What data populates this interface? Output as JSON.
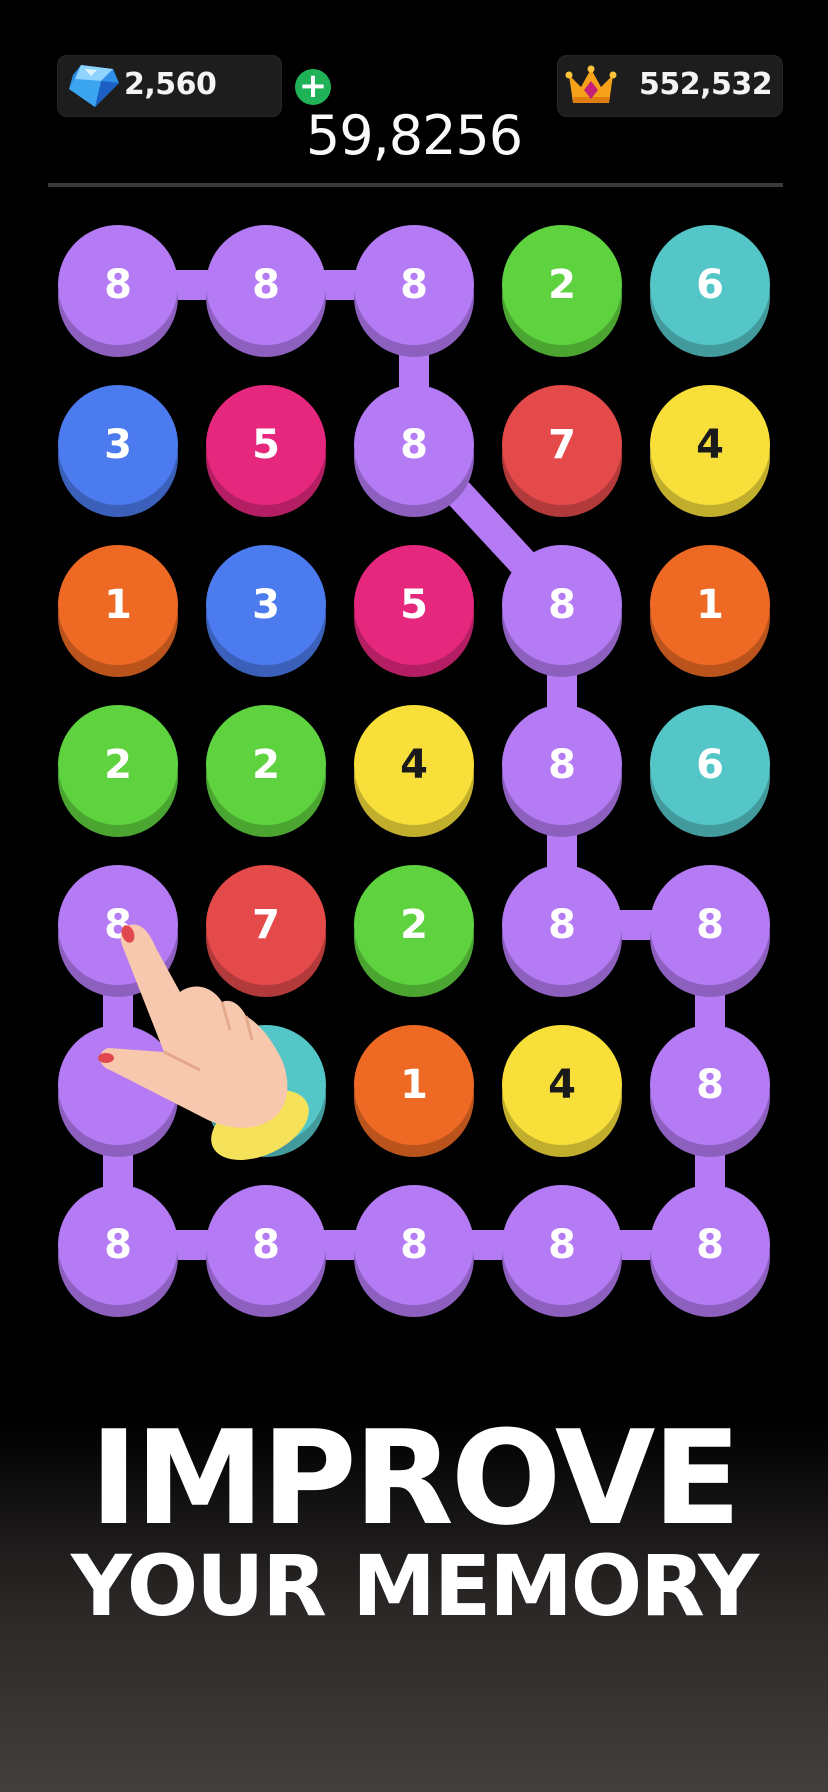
{
  "hud": {
    "gems": "2,560",
    "crown_score": "552,532",
    "current_score": "59,8256"
  },
  "colors": {
    "purple": "#b57bf5",
    "green": "#5fd33f",
    "teal": "#55c6c8",
    "blue": "#4b7bef",
    "pink": "#e5287d",
    "red": "#e54a4a",
    "yellow": "#f9df3a",
    "orange": "#ee6a24"
  },
  "board": {
    "rows": [
      [
        {
          "v": "8",
          "c": "purple"
        },
        {
          "v": "8",
          "c": "purple"
        },
        {
          "v": "8",
          "c": "purple"
        },
        {
          "v": "2",
          "c": "green"
        },
        {
          "v": "6",
          "c": "teal"
        }
      ],
      [
        {
          "v": "3",
          "c": "blue"
        },
        {
          "v": "5",
          "c": "pink"
        },
        {
          "v": "8",
          "c": "purple"
        },
        {
          "v": "7",
          "c": "red"
        },
        {
          "v": "4",
          "c": "yellow"
        }
      ],
      [
        {
          "v": "1",
          "c": "orange"
        },
        {
          "v": "3",
          "c": "blue"
        },
        {
          "v": "5",
          "c": "pink"
        },
        {
          "v": "8",
          "c": "purple"
        },
        {
          "v": "1",
          "c": "orange"
        }
      ],
      [
        {
          "v": "2",
          "c": "green"
        },
        {
          "v": "2",
          "c": "green"
        },
        {
          "v": "4",
          "c": "yellow"
        },
        {
          "v": "8",
          "c": "purple"
        },
        {
          "v": "6",
          "c": "teal"
        }
      ],
      [
        {
          "v": "8",
          "c": "purple"
        },
        {
          "v": "7",
          "c": "red"
        },
        {
          "v": "2",
          "c": "green"
        },
        {
          "v": "8",
          "c": "purple"
        },
        {
          "v": "8",
          "c": "purple"
        }
      ],
      [
        {
          "v": "",
          "c": "purple"
        },
        {
          "v": "",
          "c": "teal"
        },
        {
          "v": "1",
          "c": "orange"
        },
        {
          "v": "4",
          "c": "yellow"
        },
        {
          "v": "8",
          "c": "purple"
        }
      ],
      [
        {
          "v": "8",
          "c": "purple"
        },
        {
          "v": "8",
          "c": "purple"
        },
        {
          "v": "8",
          "c": "purple"
        },
        {
          "v": "8",
          "c": "purple"
        },
        {
          "v": "8",
          "c": "purple"
        }
      ]
    ],
    "path": [
      [
        0,
        0
      ],
      [
        0,
        1
      ],
      [
        0,
        2
      ],
      [
        1,
        2
      ],
      [
        2,
        3
      ],
      [
        3,
        3
      ],
      [
        4,
        3
      ],
      [
        4,
        4
      ],
      [
        5,
        4
      ],
      [
        6,
        4
      ],
      [
        6,
        3
      ],
      [
        6,
        2
      ],
      [
        6,
        1
      ],
      [
        6,
        0
      ],
      [
        5,
        0
      ],
      [
        4,
        0
      ]
    ]
  },
  "slogan": {
    "line1": "IMPROVE",
    "line2": "YOUR MEMORY"
  }
}
